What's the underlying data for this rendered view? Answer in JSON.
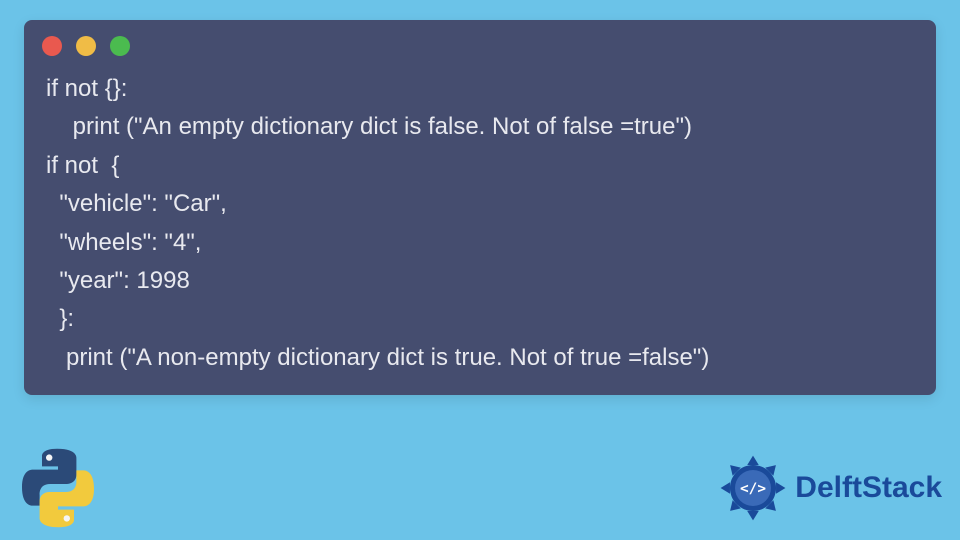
{
  "code": {
    "lines": [
      "if not {}:",
      "    print (\"An empty dictionary dict is false. Not of false =true\")",
      "if not  {",
      "  \"vehicle\": \"Car\",",
      "  \"wheels\": \"4\",",
      "  \"year\": 1998",
      "  }:",
      "   print (\"A non-empty dictionary dict is true. Not of true =false\")"
    ]
  },
  "brand": {
    "name": "DelftStack"
  },
  "colors": {
    "background": "#6bc3e8",
    "window_bg": "#454d6f",
    "code_text": "#e8e9ef",
    "brand_blue": "#1a4a9a"
  }
}
